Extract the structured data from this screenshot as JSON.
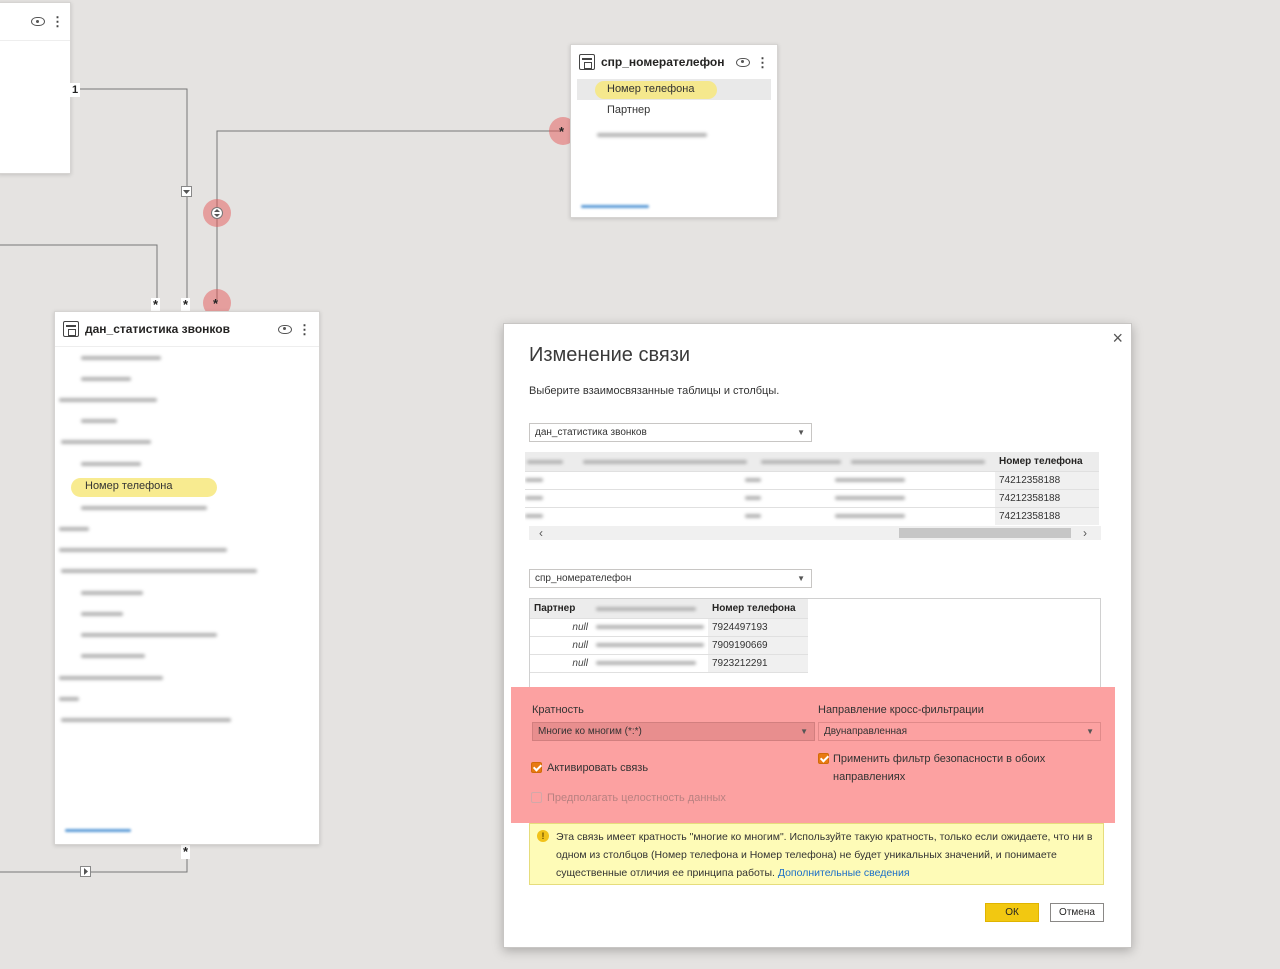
{
  "canvas": {
    "left_table": {
      "title": "дан_статистика звонков",
      "highlighted_field": "Номер телефона"
    },
    "right_table": {
      "title": "спр_номерателефон",
      "fields": [
        "Номер телефона",
        "Партнер"
      ]
    },
    "relationship_badges": {
      "one": "1",
      "many": "*"
    }
  },
  "dialog": {
    "title": "Изменение связи",
    "subtitle": "Выберите взаимосвязанные таблицы и столбцы.",
    "close_label": "×",
    "table1": {
      "selected": "дан_статистика звонков",
      "visible_header": "Номер телефона",
      "values": [
        "74212358188",
        "74212358188",
        "74212358188"
      ]
    },
    "table2": {
      "selected": "спр_номерателефон",
      "headers": [
        "Партнер",
        "Номер телефона"
      ],
      "rows": [
        {
          "partner": "null",
          "phone": "7924497193"
        },
        {
          "partner": "null",
          "phone": "7909190669"
        },
        {
          "partner": "null",
          "phone": "7923212291"
        }
      ]
    },
    "cardinality": {
      "label": "Кратность",
      "value": "Многие ко многим (*:*)"
    },
    "cross_filter": {
      "label": "Направление кросс-фильтрации",
      "value": "Двунаправленная"
    },
    "activate": {
      "label": "Активировать связь",
      "checked": true
    },
    "apply_security": {
      "label_line1": "Применить фильтр безопасности в обоих",
      "label_line2": "направлениях",
      "checked": true
    },
    "assume_integrity": {
      "label": "Предполагать целостность данных",
      "checked": false,
      "enabled": false
    },
    "warning": {
      "text": "Эта связь имеет кратность \"многие ко многим\". Используйте такую кратность, только если ожидаете, что ни в одном из столбцов (Номер телефона и Номер телефона) не будет уникальных значений, и понимаете существенные отличия ее принципа работы.",
      "link": "Дополнительные сведения"
    },
    "ok_label": "ОК",
    "cancel_label": "Отмена"
  },
  "colors": {
    "canvas_bg": "#e5e3e1",
    "highlight_yellow": "#f7e77d",
    "alert_red": "#fca1a1",
    "checkbox_orange": "#e87a12",
    "ok_yellow": "#f2c811",
    "warning_bg": "#fefbb7"
  }
}
